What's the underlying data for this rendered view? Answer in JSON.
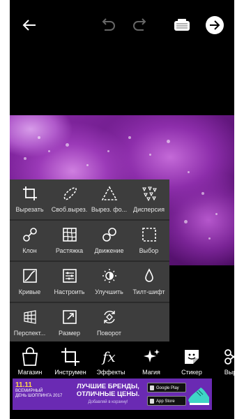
{
  "topbar": {
    "back_icon": "arrow-left-icon",
    "undo_icon": "undo-icon",
    "redo_icon": "redo-icon",
    "save_icon": "gift-box-icon",
    "next_icon": "arrow-right-circle-icon"
  },
  "tools_panel": {
    "items": [
      {
        "label": "Вырезать",
        "icon": "crop-icon"
      },
      {
        "label": "Своб.вырез.",
        "icon": "freecrop-icon"
      },
      {
        "label": "Вырез. фо...",
        "icon": "shape-crop-icon"
      },
      {
        "label": "Дисперсия",
        "icon": "dispersion-icon"
      },
      {
        "label": "Клон",
        "icon": "clone-icon"
      },
      {
        "label": "Растяжка",
        "icon": "stretch-icon"
      },
      {
        "label": "Движение",
        "icon": "motion-icon"
      },
      {
        "label": "Выбор",
        "icon": "selection-icon"
      },
      {
        "label": "Кривые",
        "icon": "curves-icon"
      },
      {
        "label": "Настроить",
        "icon": "adjust-icon"
      },
      {
        "label": "Улучшить",
        "icon": "enhance-icon"
      },
      {
        "label": "Тилт-шифт",
        "icon": "tiltshift-icon"
      },
      {
        "label": "Перспект...",
        "icon": "perspective-icon"
      },
      {
        "label": "Размер",
        "icon": "resize-icon"
      },
      {
        "label": "Поворот",
        "icon": "rotate-icon"
      }
    ]
  },
  "bottom_bar": {
    "items": [
      {
        "label": "Магазин",
        "icon": "shop-bag-icon"
      },
      {
        "label": "Инструмен",
        "icon": "crop-tool-icon"
      },
      {
        "label": "Эффекты",
        "icon": "fx-icon"
      },
      {
        "label": "Магия",
        "icon": "magic-sparkle-icon"
      },
      {
        "label": "Стикер",
        "icon": "sticker-icon"
      },
      {
        "label": "Выре",
        "icon": "cutout-icon"
      }
    ]
  },
  "ad": {
    "badge_date": "11.11",
    "badge_line1": "ВСЕМИРНЫЙ",
    "badge_line2": "ДЕНЬ ШОППИНГА 2017",
    "headline": "ЛУЧШИЕ БРЕНДЫ, ОТЛИЧНЫЕ ЦЕНЫ.",
    "subline": "Добавляй в корзину!",
    "google_play": "Google Play",
    "app_store": "App Store"
  },
  "colors": {
    "panel_bg": "#3d3d3d",
    "ad_bg": "#6a2ab3",
    "photo_accent": "#9b3ab8"
  }
}
